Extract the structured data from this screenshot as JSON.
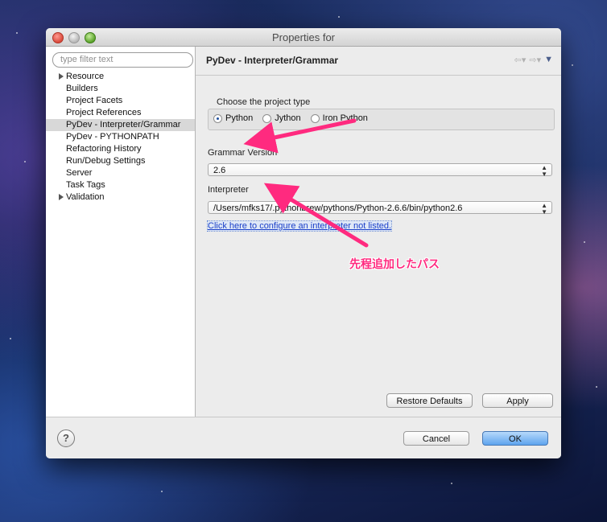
{
  "window": {
    "title": "Properties for"
  },
  "left_pane": {
    "filter_placeholder": "type filter text",
    "items": [
      {
        "label": "Resource",
        "expandable": true
      },
      {
        "label": "Builders"
      },
      {
        "label": "Project Facets"
      },
      {
        "label": "Project References"
      },
      {
        "label": "PyDev - Interpreter/Grammar",
        "selected": true
      },
      {
        "label": "PyDev - PYTHONPATH"
      },
      {
        "label": "Refactoring History"
      },
      {
        "label": "Run/Debug Settings"
      },
      {
        "label": "Server"
      },
      {
        "label": "Task Tags"
      },
      {
        "label": "Validation",
        "expandable": true
      }
    ]
  },
  "right_pane": {
    "title": "PyDev - Interpreter/Grammar",
    "nav_icons": [
      "back-arrow-icon",
      "forward-arrow-icon",
      "view-menu-icon"
    ],
    "project_type": {
      "label": "Choose the project type",
      "options": [
        "Python",
        "Jython",
        "Iron Python"
      ],
      "selected": "Python"
    },
    "grammar": {
      "label": "Grammar Version",
      "value": "2.6"
    },
    "interpreter": {
      "label": "Interpreter",
      "value": "/Users/mfks17/.pythonbrew/pythons/Python-2.6.6/bin/python2.6"
    },
    "configure_link": "Click here to configure an interpreter not listed.",
    "restore_defaults": "Restore Defaults",
    "apply": "Apply"
  },
  "bottom_bar": {
    "help": "?",
    "cancel": "Cancel",
    "ok": "OK"
  },
  "annotation": {
    "text": "先程追加したパス",
    "color": "#ff2a7f"
  }
}
